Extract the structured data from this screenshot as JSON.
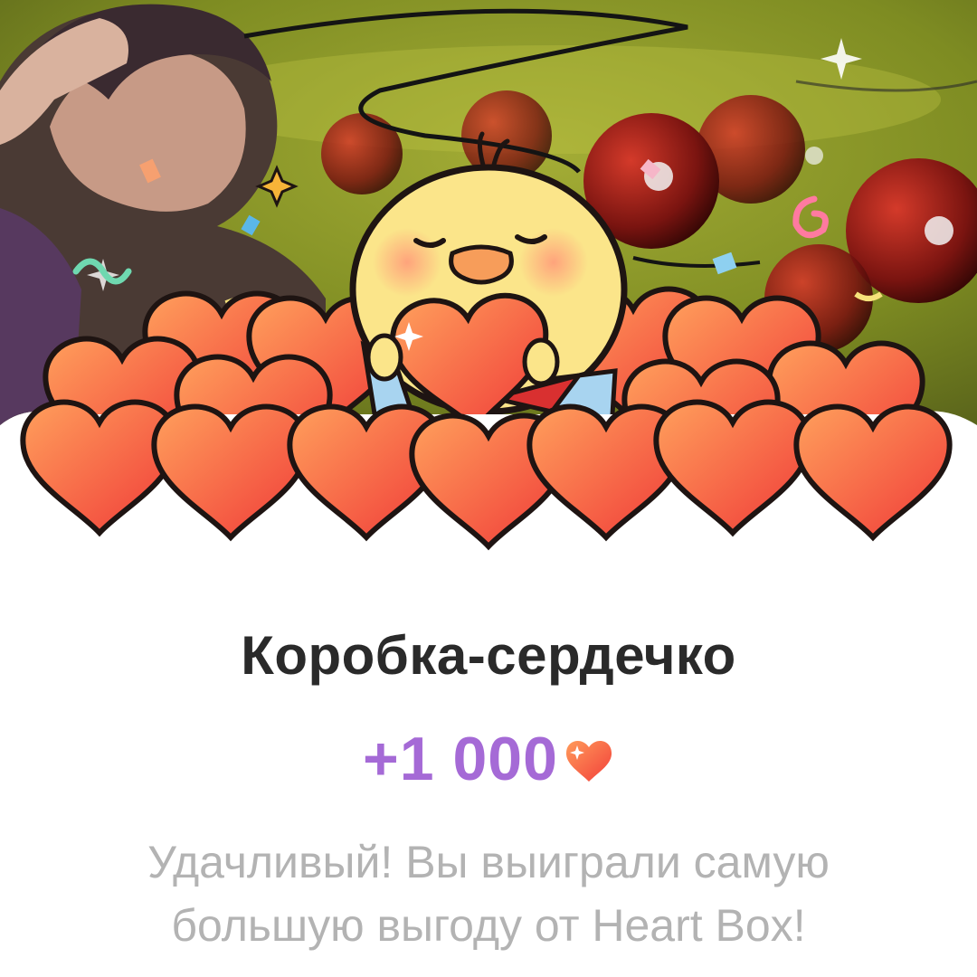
{
  "reward_sheet": {
    "title": "Коробка-сердечко",
    "amount": "+1 000",
    "currency_icon": "heart-icon",
    "message": "Удачливый! Вы выиграли самую большую выгоду от Heart Box!"
  },
  "colors": {
    "title": "#2a2a2a",
    "amount": "#a56ad6",
    "message": "#b3b3b3",
    "heart_light": "#ff9a5a",
    "heart_dark": "#f23f3a",
    "outline": "#1e1412",
    "background_green": "#8a9a2a"
  }
}
